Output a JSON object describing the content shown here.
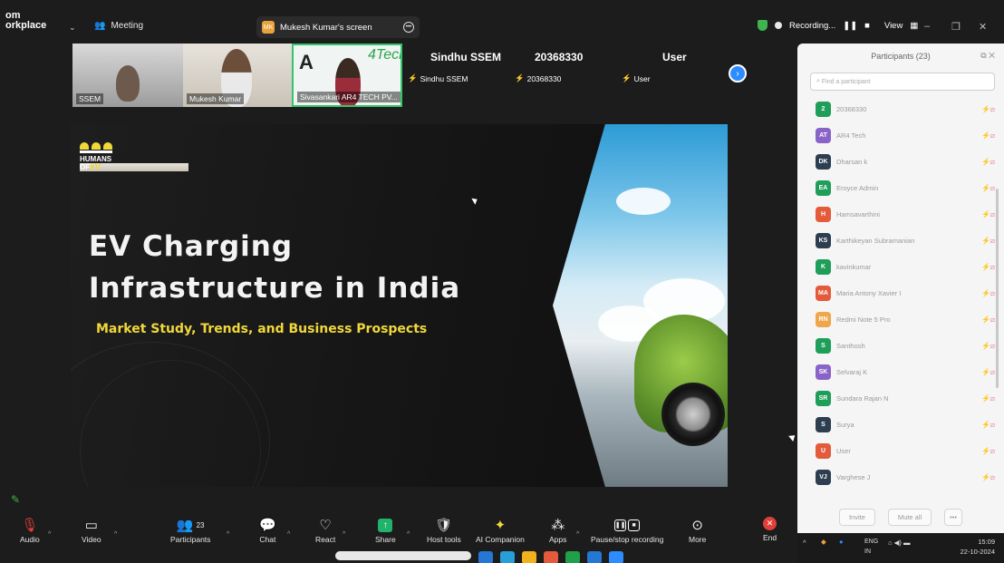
{
  "topbar": {
    "brand_line1": "om",
    "brand_line2": "orkplace",
    "meeting_label": "Meeting",
    "screen_label": "Mukesh Kumar's screen",
    "recording_label": "Recording...",
    "view_label": "View"
  },
  "thumbnails": {
    "video": [
      {
        "name": "SSEM"
      },
      {
        "name": "Mukesh Kumar"
      },
      {
        "name": "Sivasankari AR4 TECH PV..."
      }
    ],
    "tiles": [
      {
        "big": "Sindhu SSEM",
        "small": "Sindhu SSEM"
      },
      {
        "big": "20368330",
        "small": "20368330"
      },
      {
        "big": "User",
        "small": "User"
      }
    ]
  },
  "slide": {
    "logo_line1": "HUMANS",
    "logo_line2": "OF",
    "logo_ev": "eV",
    "title_line1": "EV Charging",
    "title_line2": "Infrastructure in India",
    "subtitle": "Market Study, Trends, and Business Prospects"
  },
  "participants": {
    "title": "Participants (23)",
    "search_placeholder": "Find a participant",
    "list": [
      {
        "initials": "2",
        "name": "20368330",
        "color": "#1f9e5a"
      },
      {
        "initials": "AT",
        "name": "AR4 Tech",
        "color": "#8a63c9"
      },
      {
        "initials": "DK",
        "name": "Dharsan k",
        "color": "#2c3e50"
      },
      {
        "initials": "EA",
        "name": "Eroyce Admin",
        "color": "#1f9e5a"
      },
      {
        "initials": "H",
        "name": "Hamsavarthini",
        "color": "#e35b3b"
      },
      {
        "initials": "KS",
        "name": "Karthikeyan Subramanian",
        "color": "#2c3e50"
      },
      {
        "initials": "K",
        "name": "kavinkumar",
        "color": "#1f9e5a"
      },
      {
        "initials": "MA",
        "name": "Maria Antony Xavier I",
        "color": "#e35b3b"
      },
      {
        "initials": "RN",
        "name": "Redmi Note 5 Pro",
        "color": "#f0a64b"
      },
      {
        "initials": "S",
        "name": "Santhosh",
        "color": "#1f9e5a"
      },
      {
        "initials": "SK",
        "name": "Selvaraj K",
        "color": "#8a63c9"
      },
      {
        "initials": "SR",
        "name": "Sundara Rajan N",
        "color": "#1f9e5a"
      },
      {
        "initials": "S",
        "name": "Surya",
        "color": "#2c3e50"
      },
      {
        "initials": "U",
        "name": "User",
        "color": "#e35b3b"
      },
      {
        "initials": "VJ",
        "name": "Varghese J",
        "color": "#2c3e50"
      }
    ],
    "invite_label": "Invite",
    "mute_all_label": "Mute all"
  },
  "toolbar": {
    "audio": "Audio",
    "video": "Video",
    "participants": "Participants",
    "participants_count": "23",
    "chat": "Chat",
    "react": "React",
    "share": "Share",
    "host_tools": "Host tools",
    "ai_companion": "AI Companion",
    "apps": "Apps",
    "pause_recording": "Pause/stop recording",
    "more": "More",
    "end": "End"
  },
  "taskbar": {
    "lang": "ENG",
    "lang2": "IN",
    "time": "15:09",
    "date": "22-10-2024"
  }
}
